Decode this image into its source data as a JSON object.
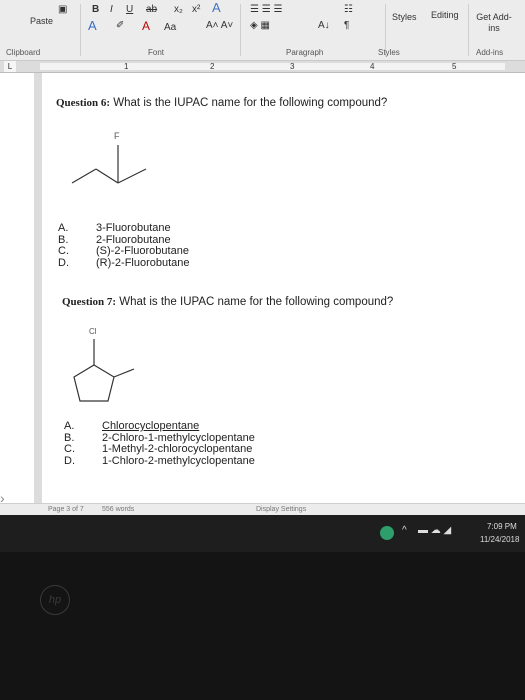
{
  "ribbon": {
    "paste_label": "Paste",
    "clipboard_label": "Clipboard",
    "font_label": "Font",
    "paragraph_label": "Paragraph",
    "styles_label": "Styles",
    "styles_group_label": "Styles",
    "editing_label": "Editing",
    "addins_label": "Get Add-ins",
    "addins_group_label": "Add-ins",
    "font_size_label": "Aa"
  },
  "ruler": {
    "left_marker": "L",
    "numbers": [
      "1",
      "2",
      "3",
      "4",
      "5"
    ]
  },
  "q6": {
    "prefix": "Question 6:",
    "text": " What is the IUPAC name for the following compound?",
    "atom_label": "F",
    "letters": [
      "A.",
      "B.",
      "C.",
      "D."
    ],
    "options": [
      "3-Fluorobutane",
      "2-Fluorobutane",
      "(S)-2-Fluorobutane",
      "(R)-2-Fluorobutane"
    ]
  },
  "q7": {
    "prefix": "Question 7:",
    "text": " What is the IUPAC name for the following compound?",
    "atom_label": "Cl",
    "letters": [
      "A.",
      "B.",
      "C.",
      "D."
    ],
    "options": [
      "Chlorocyclopentane",
      "2-Chloro-1-methylcyclopentane",
      "1-Methyl-2-chlorocyclopentane",
      "1-Chloro-2-methylcyclopentane"
    ]
  },
  "status": {
    "page": "Page 3 of 7",
    "words": "556 words",
    "display": "Display Settings"
  },
  "taskbar": {
    "time": "7:09 PM",
    "date": "11/24/2018"
  },
  "logo_text": "hp"
}
